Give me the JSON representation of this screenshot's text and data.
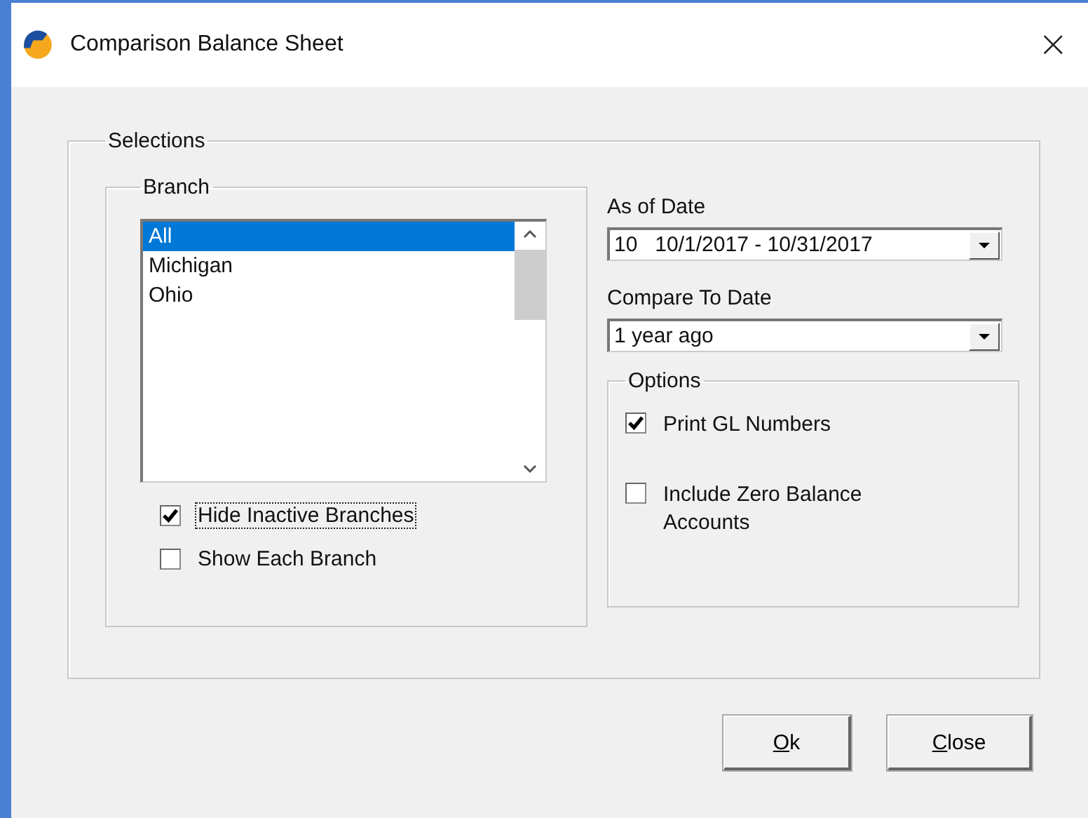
{
  "window": {
    "title": "Comparison Balance Sheet",
    "close": "×"
  },
  "selections": {
    "label": "Selections",
    "branch": {
      "label": "Branch",
      "items": [
        {
          "label": "All",
          "selected": true
        },
        {
          "label": "Michigan",
          "selected": false
        },
        {
          "label": "Ohio",
          "selected": false
        }
      ],
      "checkboxes": [
        {
          "label": "Hide Inactive Branches",
          "checked": true,
          "focused": true
        },
        {
          "label": "Show Each Branch",
          "checked": false,
          "focused": false
        }
      ]
    },
    "as_of_date": {
      "label": "As of Date",
      "value": "10   10/1/2017 - 10/31/2017"
    },
    "compare_to_date": {
      "label": "Compare To Date",
      "value": "1 year ago"
    },
    "options": {
      "label": "Options",
      "checkboxes": [
        {
          "label": "Print GL Numbers",
          "checked": true
        },
        {
          "label": "Include Zero Balance Accounts",
          "checked": false
        }
      ]
    }
  },
  "buttons": [
    {
      "label": "Ok"
    },
    {
      "label": "Close"
    }
  ]
}
